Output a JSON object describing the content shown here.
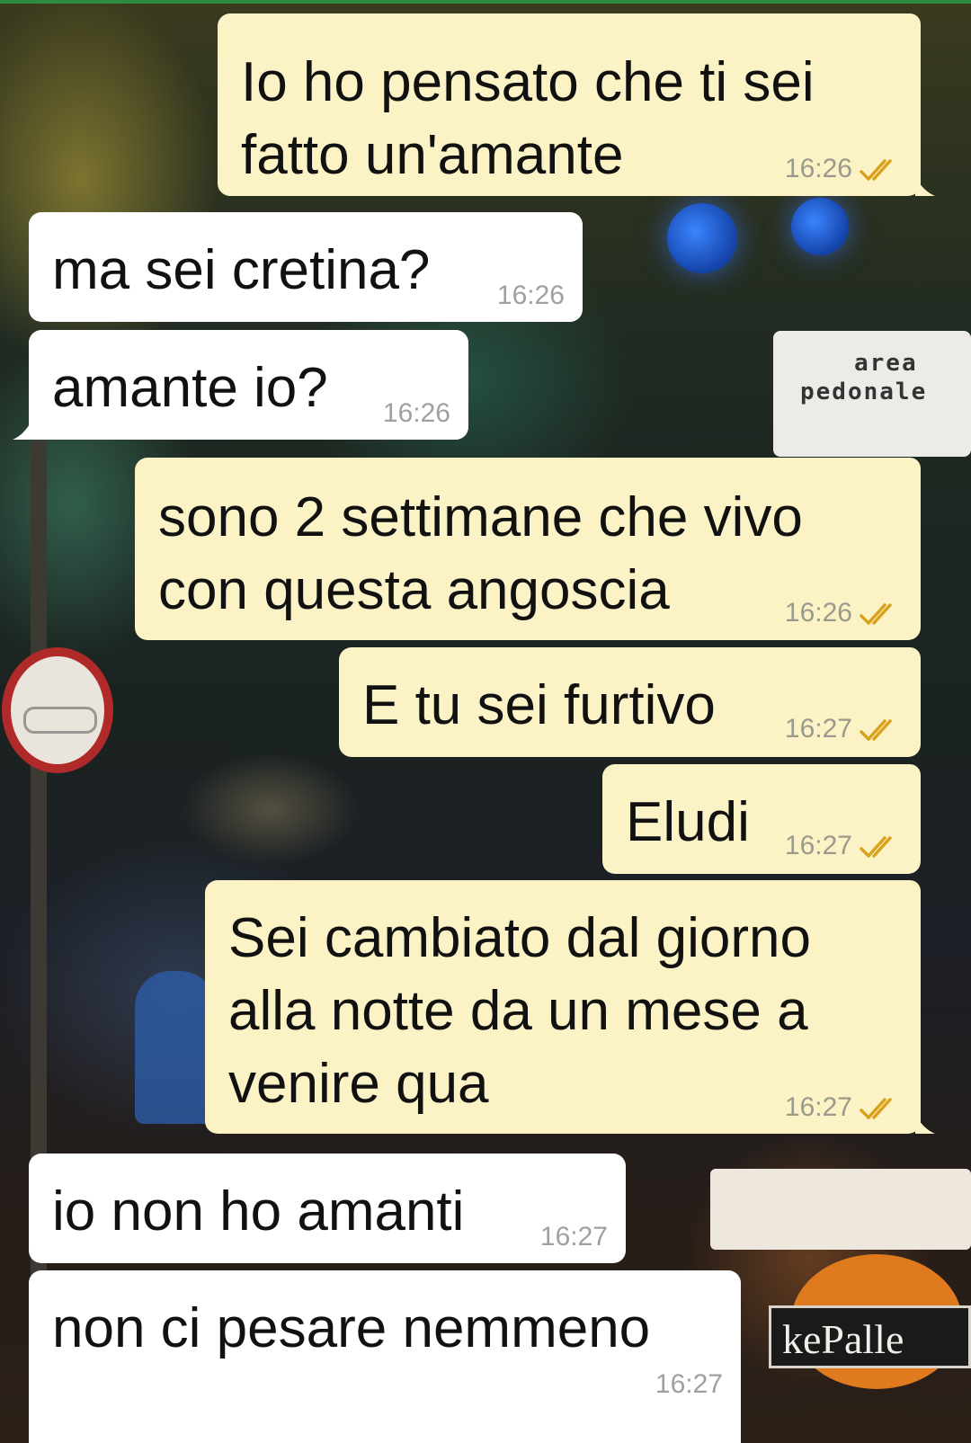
{
  "colors": {
    "outgoing_bubble": "#fbf3c6",
    "incoming_bubble": "#ffffff",
    "tick_color": "#d9a21c",
    "timestamp": "#9a9a8c"
  },
  "background": {
    "sign_area_line1": "area",
    "sign_area_line2": "pedonale",
    "sign_brand": "kePalle"
  },
  "messages": [
    {
      "direction": "out",
      "text": "Io ho pensato che ti sei\nfatto un'amante",
      "time": "16:26",
      "status_icon": "double-check-icon"
    },
    {
      "direction": "in",
      "text": "ma sei cretina?",
      "time": "16:26"
    },
    {
      "direction": "in",
      "text": "amante io?",
      "time": "16:26"
    },
    {
      "direction": "out",
      "text": "sono 2 settimane che vivo\ncon questa angoscia",
      "time": "16:26",
      "status_icon": "double-check-icon"
    },
    {
      "direction": "out",
      "text": "E tu sei furtivo",
      "time": "16:27",
      "status_icon": "double-check-icon"
    },
    {
      "direction": "out",
      "text": "Eludi",
      "time": "16:27",
      "status_icon": "double-check-icon"
    },
    {
      "direction": "out",
      "text": "Sei cambiato dal giorno\nalla notte da un mese a\nvenire qua",
      "time": "16:27",
      "status_icon": "double-check-icon"
    },
    {
      "direction": "in",
      "text": "io non ho amanti",
      "time": "16:27"
    },
    {
      "direction": "in",
      "text": "non ci pesare nemmeno",
      "time": "16:27"
    }
  ]
}
